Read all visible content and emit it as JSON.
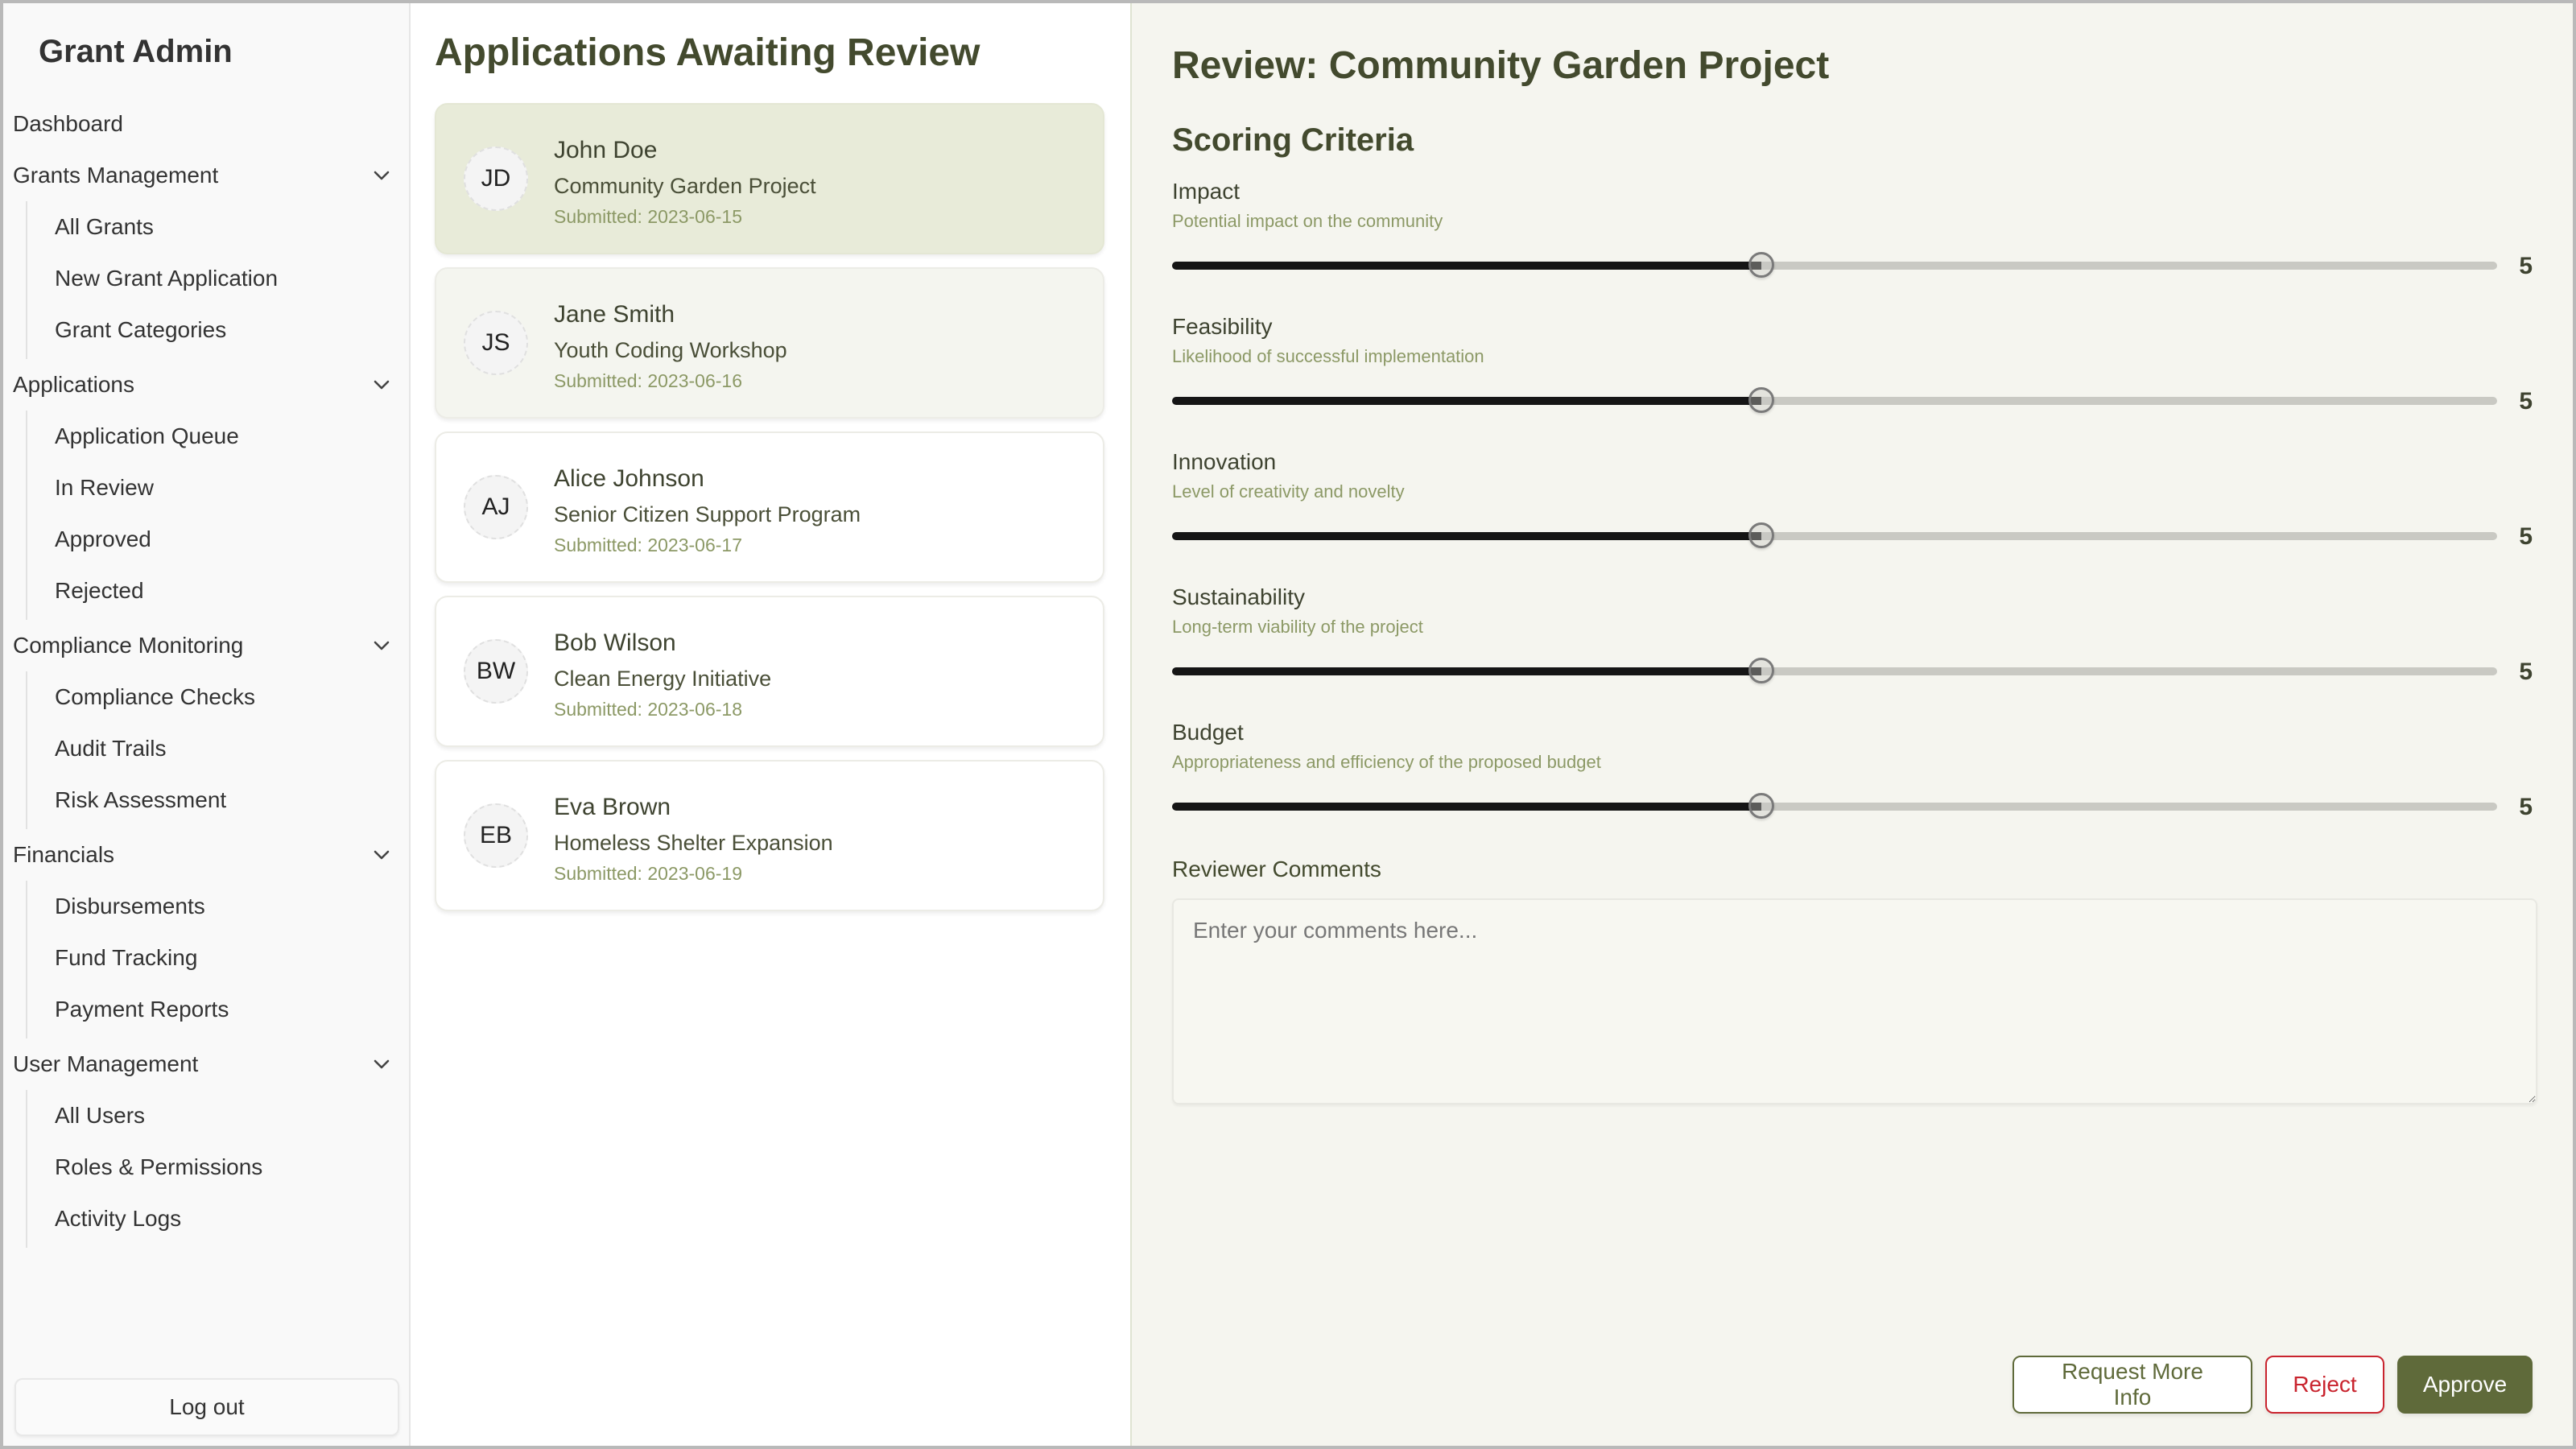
{
  "sidebar": {
    "brand": "Grant Admin",
    "dashboard": "Dashboard",
    "groups": [
      {
        "label": "Grants Management",
        "items": [
          "All Grants",
          "New Grant Application",
          "Grant Categories"
        ]
      },
      {
        "label": "Applications",
        "items": [
          "Application Queue",
          "In Review",
          "Approved",
          "Rejected"
        ]
      },
      {
        "label": "Compliance Monitoring",
        "items": [
          "Compliance Checks",
          "Audit Trails",
          "Risk Assessment"
        ]
      },
      {
        "label": "Financials",
        "items": [
          "Disbursements",
          "Fund Tracking",
          "Payment Reports"
        ]
      },
      {
        "label": "User Management",
        "items": [
          "All Users",
          "Roles & Permissions",
          "Activity Logs"
        ]
      }
    ],
    "logout": "Log out"
  },
  "list": {
    "title": "Applications Awaiting Review",
    "applications": [
      {
        "initials": "JD",
        "name": "John Doe",
        "project": "Community Garden Project",
        "submitted": "Submitted: 2023-06-15",
        "state": "selected"
      },
      {
        "initials": "JS",
        "name": "Jane Smith",
        "project": "Youth Coding Workshop",
        "submitted": "Submitted: 2023-06-16",
        "state": "hover"
      },
      {
        "initials": "AJ",
        "name": "Alice Johnson",
        "project": "Senior Citizen Support Program",
        "submitted": "Submitted: 2023-06-17",
        "state": ""
      },
      {
        "initials": "BW",
        "name": "Bob Wilson",
        "project": "Clean Energy Initiative",
        "submitted": "Submitted: 2023-06-18",
        "state": ""
      },
      {
        "initials": "EB",
        "name": "Eva Brown",
        "project": "Homeless Shelter Expansion",
        "submitted": "Submitted: 2023-06-19",
        "state": ""
      }
    ]
  },
  "review": {
    "title": "Review: Community Garden Project",
    "section_title": "Scoring Criteria",
    "score_min": 1,
    "score_max": 10,
    "criteria": [
      {
        "name": "Impact",
        "description": "Potential impact on the community",
        "value": 5
      },
      {
        "name": "Feasibility",
        "description": "Likelihood of successful implementation",
        "value": 5
      },
      {
        "name": "Innovation",
        "description": "Level of creativity and novelty",
        "value": 5
      },
      {
        "name": "Sustainability",
        "description": "Long-term viability of the project",
        "value": 5
      },
      {
        "name": "Budget",
        "description": "Appropriateness and efficiency of the proposed budget",
        "value": 5
      }
    ],
    "comments_label": "Reviewer Comments",
    "comments_placeholder": "Enter your comments here...",
    "comments_value": "",
    "buttons": {
      "request_info": "Request More Info",
      "reject": "Reject",
      "approve": "Approve"
    }
  },
  "colors": {
    "accent": "#5f6a3a",
    "heading": "#434a2e",
    "muted_green": "#8c9966",
    "danger": "#c9242e",
    "selected_card": "#e8ebd9",
    "review_bg": "#f5f5ef"
  }
}
